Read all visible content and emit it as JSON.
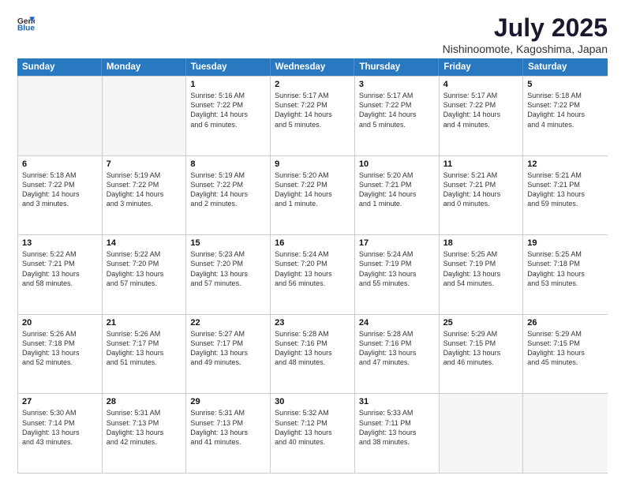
{
  "header": {
    "logo_general": "General",
    "logo_blue": "Blue",
    "month_year": "July 2025",
    "location": "Nishinoomote, Kagoshima, Japan"
  },
  "weekdays": [
    "Sunday",
    "Monday",
    "Tuesday",
    "Wednesday",
    "Thursday",
    "Friday",
    "Saturday"
  ],
  "weeks": [
    [
      {
        "day": "",
        "info": [],
        "empty": true
      },
      {
        "day": "",
        "info": [],
        "empty": true
      },
      {
        "day": "1",
        "info": [
          "Sunrise: 5:16 AM",
          "Sunset: 7:22 PM",
          "Daylight: 14 hours",
          "and 6 minutes."
        ]
      },
      {
        "day": "2",
        "info": [
          "Sunrise: 5:17 AM",
          "Sunset: 7:22 PM",
          "Daylight: 14 hours",
          "and 5 minutes."
        ]
      },
      {
        "day": "3",
        "info": [
          "Sunrise: 5:17 AM",
          "Sunset: 7:22 PM",
          "Daylight: 14 hours",
          "and 5 minutes."
        ]
      },
      {
        "day": "4",
        "info": [
          "Sunrise: 5:17 AM",
          "Sunset: 7:22 PM",
          "Daylight: 14 hours",
          "and 4 minutes."
        ]
      },
      {
        "day": "5",
        "info": [
          "Sunrise: 5:18 AM",
          "Sunset: 7:22 PM",
          "Daylight: 14 hours",
          "and 4 minutes."
        ]
      }
    ],
    [
      {
        "day": "6",
        "info": [
          "Sunrise: 5:18 AM",
          "Sunset: 7:22 PM",
          "Daylight: 14 hours",
          "and 3 minutes."
        ]
      },
      {
        "day": "7",
        "info": [
          "Sunrise: 5:19 AM",
          "Sunset: 7:22 PM",
          "Daylight: 14 hours",
          "and 3 minutes."
        ]
      },
      {
        "day": "8",
        "info": [
          "Sunrise: 5:19 AM",
          "Sunset: 7:22 PM",
          "Daylight: 14 hours",
          "and 2 minutes."
        ]
      },
      {
        "day": "9",
        "info": [
          "Sunrise: 5:20 AM",
          "Sunset: 7:22 PM",
          "Daylight: 14 hours",
          "and 1 minute."
        ]
      },
      {
        "day": "10",
        "info": [
          "Sunrise: 5:20 AM",
          "Sunset: 7:21 PM",
          "Daylight: 14 hours",
          "and 1 minute."
        ]
      },
      {
        "day": "11",
        "info": [
          "Sunrise: 5:21 AM",
          "Sunset: 7:21 PM",
          "Daylight: 14 hours",
          "and 0 minutes."
        ]
      },
      {
        "day": "12",
        "info": [
          "Sunrise: 5:21 AM",
          "Sunset: 7:21 PM",
          "Daylight: 13 hours",
          "and 59 minutes."
        ]
      }
    ],
    [
      {
        "day": "13",
        "info": [
          "Sunrise: 5:22 AM",
          "Sunset: 7:21 PM",
          "Daylight: 13 hours",
          "and 58 minutes."
        ]
      },
      {
        "day": "14",
        "info": [
          "Sunrise: 5:22 AM",
          "Sunset: 7:20 PM",
          "Daylight: 13 hours",
          "and 57 minutes."
        ]
      },
      {
        "day": "15",
        "info": [
          "Sunrise: 5:23 AM",
          "Sunset: 7:20 PM",
          "Daylight: 13 hours",
          "and 57 minutes."
        ]
      },
      {
        "day": "16",
        "info": [
          "Sunrise: 5:24 AM",
          "Sunset: 7:20 PM",
          "Daylight: 13 hours",
          "and 56 minutes."
        ]
      },
      {
        "day": "17",
        "info": [
          "Sunrise: 5:24 AM",
          "Sunset: 7:19 PM",
          "Daylight: 13 hours",
          "and 55 minutes."
        ]
      },
      {
        "day": "18",
        "info": [
          "Sunrise: 5:25 AM",
          "Sunset: 7:19 PM",
          "Daylight: 13 hours",
          "and 54 minutes."
        ]
      },
      {
        "day": "19",
        "info": [
          "Sunrise: 5:25 AM",
          "Sunset: 7:18 PM",
          "Daylight: 13 hours",
          "and 53 minutes."
        ]
      }
    ],
    [
      {
        "day": "20",
        "info": [
          "Sunrise: 5:26 AM",
          "Sunset: 7:18 PM",
          "Daylight: 13 hours",
          "and 52 minutes."
        ]
      },
      {
        "day": "21",
        "info": [
          "Sunrise: 5:26 AM",
          "Sunset: 7:17 PM",
          "Daylight: 13 hours",
          "and 51 minutes."
        ]
      },
      {
        "day": "22",
        "info": [
          "Sunrise: 5:27 AM",
          "Sunset: 7:17 PM",
          "Daylight: 13 hours",
          "and 49 minutes."
        ]
      },
      {
        "day": "23",
        "info": [
          "Sunrise: 5:28 AM",
          "Sunset: 7:16 PM",
          "Daylight: 13 hours",
          "and 48 minutes."
        ]
      },
      {
        "day": "24",
        "info": [
          "Sunrise: 5:28 AM",
          "Sunset: 7:16 PM",
          "Daylight: 13 hours",
          "and 47 minutes."
        ]
      },
      {
        "day": "25",
        "info": [
          "Sunrise: 5:29 AM",
          "Sunset: 7:15 PM",
          "Daylight: 13 hours",
          "and 46 minutes."
        ]
      },
      {
        "day": "26",
        "info": [
          "Sunrise: 5:29 AM",
          "Sunset: 7:15 PM",
          "Daylight: 13 hours",
          "and 45 minutes."
        ]
      }
    ],
    [
      {
        "day": "27",
        "info": [
          "Sunrise: 5:30 AM",
          "Sunset: 7:14 PM",
          "Daylight: 13 hours",
          "and 43 minutes."
        ]
      },
      {
        "day": "28",
        "info": [
          "Sunrise: 5:31 AM",
          "Sunset: 7:13 PM",
          "Daylight: 13 hours",
          "and 42 minutes."
        ]
      },
      {
        "day": "29",
        "info": [
          "Sunrise: 5:31 AM",
          "Sunset: 7:13 PM",
          "Daylight: 13 hours",
          "and 41 minutes."
        ]
      },
      {
        "day": "30",
        "info": [
          "Sunrise: 5:32 AM",
          "Sunset: 7:12 PM",
          "Daylight: 13 hours",
          "and 40 minutes."
        ]
      },
      {
        "day": "31",
        "info": [
          "Sunrise: 5:33 AM",
          "Sunset: 7:11 PM",
          "Daylight: 13 hours",
          "and 38 minutes."
        ]
      },
      {
        "day": "",
        "info": [],
        "empty": true
      },
      {
        "day": "",
        "info": [],
        "empty": true
      }
    ]
  ]
}
